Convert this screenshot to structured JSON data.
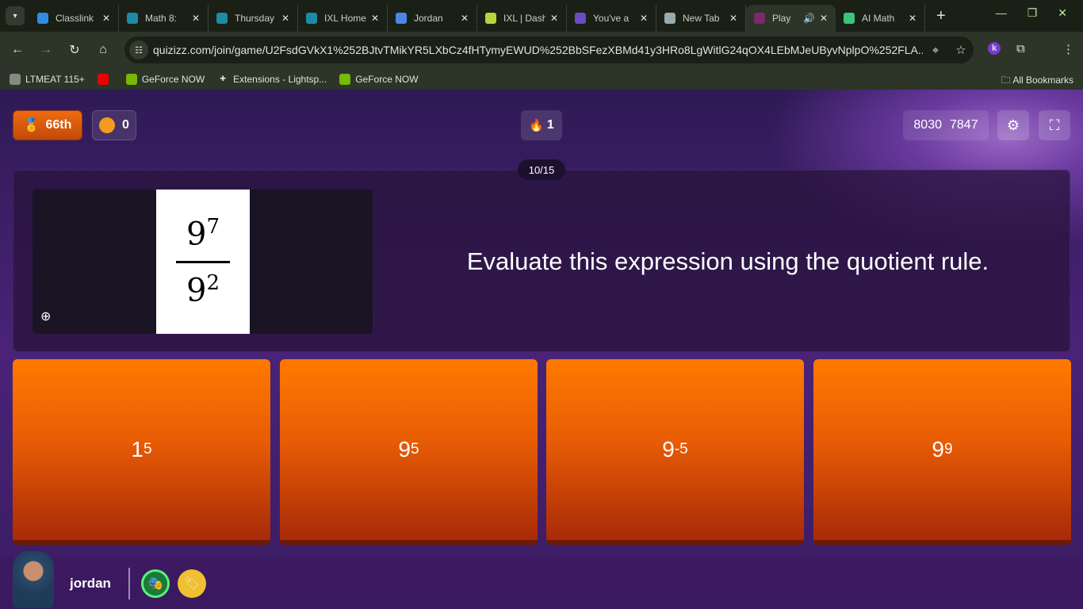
{
  "browser": {
    "tabs": [
      {
        "title": "Classlink",
        "icon": "classlink-icon",
        "color": "#2f8de4"
      },
      {
        "title": "Math 8:",
        "icon": "peardeck-icon",
        "color": "#1d8aa8"
      },
      {
        "title": "Thursday",
        "icon": "peardeck-icon",
        "color": "#1d8aa8"
      },
      {
        "title": "IXL Home",
        "icon": "peardeck-icon",
        "color": "#1d8aa8"
      },
      {
        "title": "Jordan",
        "icon": "docs-icon",
        "color": "#4a86e8"
      },
      {
        "title": "IXL | Dash",
        "icon": "ixl-icon",
        "color": "#b8d43a"
      },
      {
        "title": "You've a",
        "icon": "forms-icon",
        "color": "#6a4bc4"
      },
      {
        "title": "New Tab",
        "icon": "chrome-icon",
        "color": "#9aa"
      },
      {
        "title": "Play",
        "icon": "quizizz-icon",
        "color": "#7a2a6a",
        "active": true,
        "audio": true
      },
      {
        "title": "AI Math",
        "icon": "compass-icon",
        "color": "#3cc47c"
      }
    ],
    "url": "quizizz.com/join/game/U2FsdGVkX1%252BJtvTMikYR5LXbCz4fHTymyEWUD%252BbSFezXBMd41y3HRo8LgWitlG24qOX4LEbMJeUByvNplpO%252FLA...",
    "profile_initial": "k",
    "bookmarks": [
      {
        "label": "LTMEAT 115+",
        "icon": "globe-icon"
      },
      {
        "label": "",
        "icon": "youtube-icon"
      },
      {
        "label": "GeForce NOW",
        "icon": "nvidia-icon"
      },
      {
        "label": "Extensions - Lightsp...",
        "icon": "puzzle-icon"
      },
      {
        "label": "GeForce NOW",
        "icon": "nvidia-icon"
      }
    ],
    "all_bookmarks": "All Bookmarks"
  },
  "game": {
    "rank": "66th",
    "coins": "0",
    "streak": "1",
    "score_a": "8030",
    "score_b": "7847",
    "progress": "10/15",
    "question": "Evaluate this expression using the quotient rule.",
    "expression": {
      "num_base": "9",
      "num_exp": "7",
      "den_base": "9",
      "den_exp": "2"
    },
    "options": [
      {
        "base": "1",
        "exp": "5"
      },
      {
        "base": "9",
        "exp": "5"
      },
      {
        "base": "9",
        "exp": "-5"
      },
      {
        "base": "9",
        "exp": "9"
      }
    ],
    "colors": {
      "option": "#ff7a00",
      "rank": "#f06a10",
      "background": "#4a2378"
    },
    "username": "jordan"
  }
}
